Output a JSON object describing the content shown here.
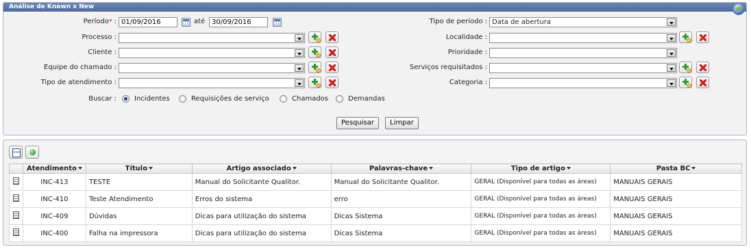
{
  "filter_panel": {
    "title": "Análise de Known x New",
    "periodo_label": "Período",
    "required_mark": "*",
    "colon": " :",
    "date_from": "01/09/2016",
    "ate_label": "até",
    "date_to": "30/09/2016",
    "tipo_periodo_label": "Tipo de período :",
    "tipo_periodo_value": "Data de abertura",
    "processo_label": "Processo :",
    "localidade_label": "Localidade :",
    "cliente_label": "Cliente :",
    "prioridade_label": "Prioridade :",
    "equipe_label": "Equipe do chamado :",
    "servicos_label": "Serviços requisitados :",
    "tipo_atendimento_label": "Tipo de atendimento :",
    "categoria_label": "Categoria :",
    "buscar_label": "Buscar :",
    "buscar_options": [
      "Incidentes",
      "Requisições de serviço",
      "Chamados",
      "Demandas"
    ],
    "buscar_selected": "Incidentes",
    "pesquisar_label": "Pesquisar",
    "limpar_label": "Limpar"
  },
  "results": {
    "columns": [
      "Atendimento",
      "Título",
      "Artigo associado",
      "Palavras-chave",
      "Tipo de artigo",
      "Pasta BC"
    ],
    "rows": [
      {
        "atendimento": "INC-413",
        "titulo": "TESTE",
        "artigo": "Manual do Solicitante Qualitor.",
        "palavras": "Manual do Solicitante Qualitor.",
        "tipo": "GERAL (Disponível para todas as áreas)",
        "pasta": "MANUAIS GERAIS"
      },
      {
        "atendimento": "INC-410",
        "titulo": "Teste Atendimento",
        "artigo": "Erros do sistema",
        "palavras": "erro",
        "tipo": "GERAL (Disponível para todas as áreas)",
        "pasta": "MANUAIS GERAIS"
      },
      {
        "atendimento": "INC-409",
        "titulo": "Dúvidas",
        "artigo": "Dicas para utilização do sistema",
        "palavras": "Dicas Sistema",
        "tipo": "GERAL (Disponível para todas as áreas)",
        "pasta": "MANUAIS GERAIS"
      },
      {
        "atendimento": "INC-400",
        "titulo": "Falha na impressora",
        "artigo": "Dicas para utilização do sistema",
        "palavras": "Dicas Sistema",
        "tipo": "GERAL (Disponível para todas as áreas)",
        "pasta": "MANUAIS GERAIS"
      }
    ]
  }
}
